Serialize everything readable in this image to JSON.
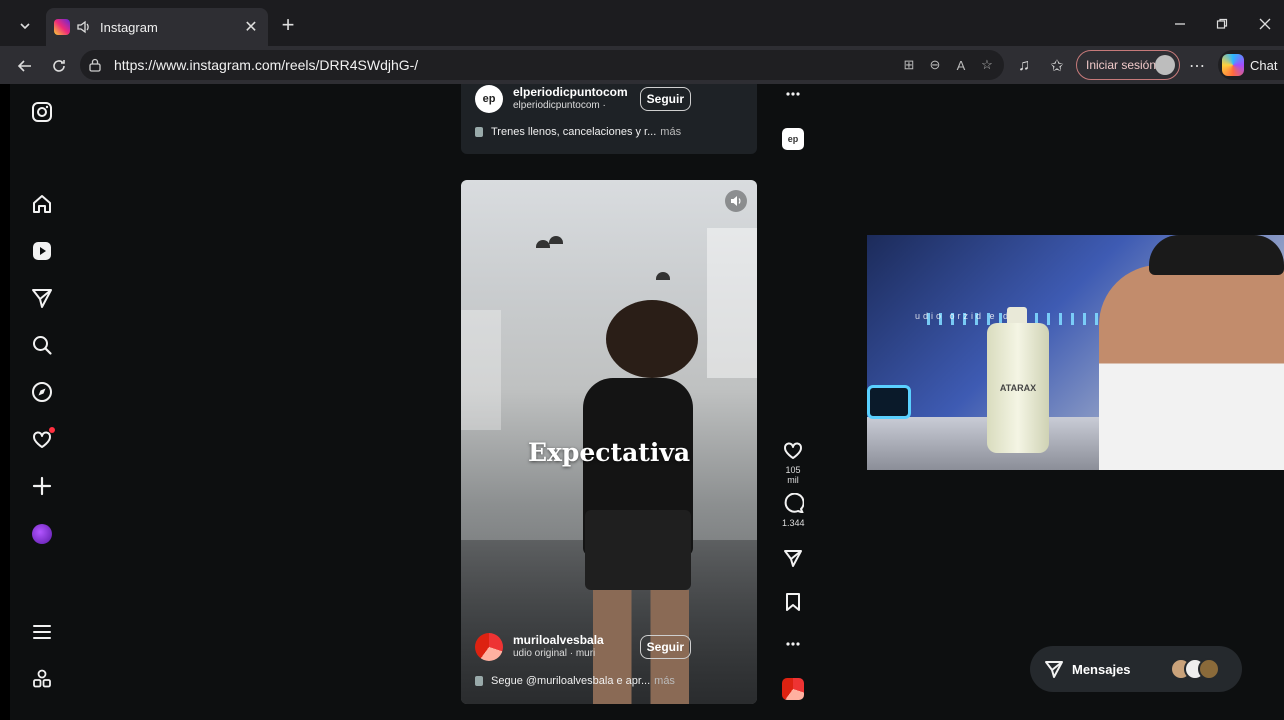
{
  "browser": {
    "tab_title": "Instagram",
    "url": "https://www.instagram.com/reels/DRR4SWdjhG-/",
    "signin_label": "Iniciar sesión",
    "copilot_label": "Chat"
  },
  "sidebar": {
    "items": [
      {
        "name": "instagram-logo-icon"
      },
      {
        "name": "home-icon"
      },
      {
        "name": "reels-icon"
      },
      {
        "name": "send-icon"
      },
      {
        "name": "search-icon"
      },
      {
        "name": "explore-compass-icon"
      },
      {
        "name": "notifications-heart-icon"
      },
      {
        "name": "create-plus-icon"
      },
      {
        "name": "profile-avatar"
      },
      {
        "name": "more-menu-icon"
      },
      {
        "name": "meta-apps-icon"
      }
    ]
  },
  "reel_top": {
    "username": "elperiodicpuntocom",
    "audio": "elperiodicpuntocom ·",
    "follow_label": "Seguir",
    "caption": "Trenes llenos, cancelaciones y r...",
    "more_label": "más",
    "avatar_text": "ep"
  },
  "reel_main": {
    "overlay_text": "Expectativa",
    "username": "muriloalvesbala",
    "audio": "udio original · muri",
    "follow_label": "Seguir",
    "caption": "Segue @muriloalvesbala e apr...",
    "more_label": "más",
    "likes": "105 mil",
    "comments": "1.344"
  },
  "webcam": {
    "bottle_label": "ATARAX",
    "overlay_text": "udio orzid  e  dop"
  },
  "messages": {
    "label": "Mensajes"
  },
  "colors": {
    "page_bg": "#0d0f10",
    "chrome_bg": "#1c1c1f",
    "signin_border": "#c77a7a",
    "notif_dot": "#ff3040"
  }
}
